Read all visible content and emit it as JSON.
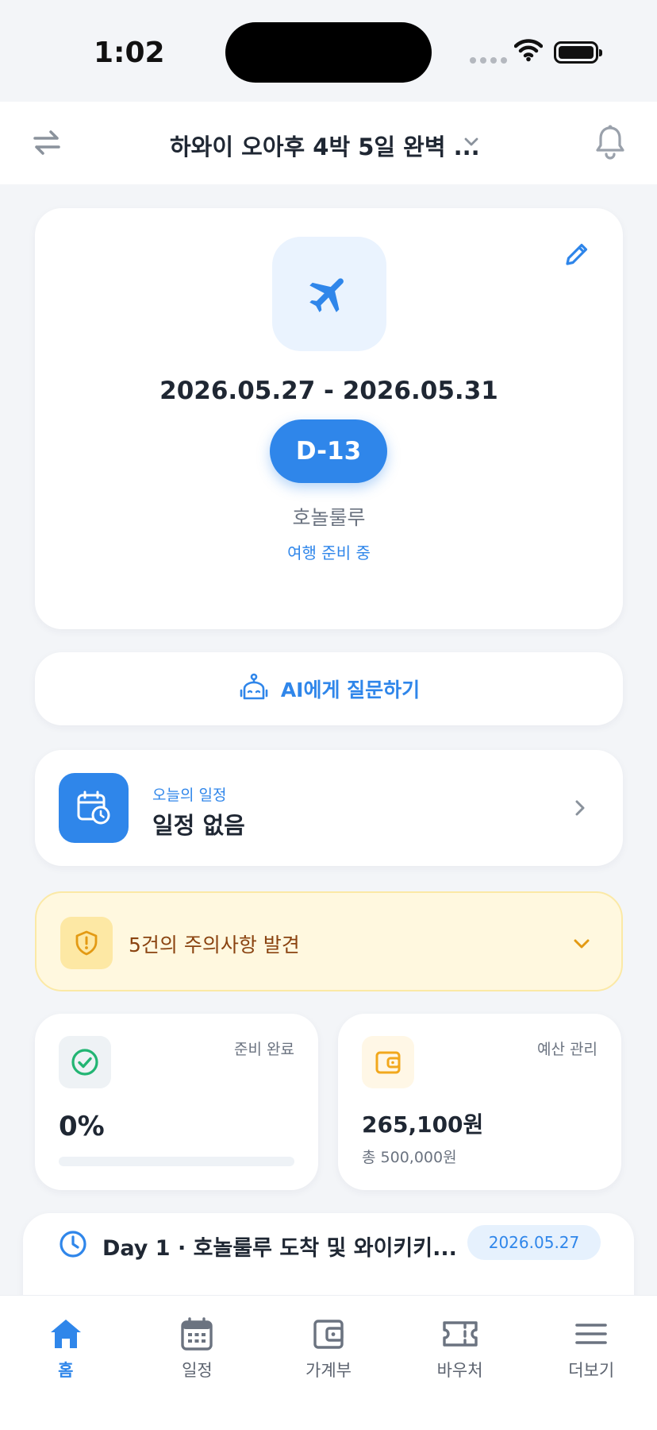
{
  "status_bar": {
    "time": "1:02"
  },
  "header": {
    "title": "하와이 오아후 4박 5일 완벽 ..."
  },
  "trip": {
    "date_range": "2026.05.27 - 2026.05.31",
    "dday": "D-13",
    "city": "호놀룰루",
    "status": "여행 준비 중"
  },
  "ai": {
    "label": "AI에게 질문하기"
  },
  "today": {
    "label": "오늘의 일정",
    "value": "일정 없음"
  },
  "warnings": {
    "label": "5건의 주의사항 발견"
  },
  "prep": {
    "label": "준비 완료",
    "value": "0%",
    "progress": 0
  },
  "budget": {
    "label": "예산 관리",
    "spent": "265,100원",
    "total": "총 500,000원"
  },
  "day": {
    "title": "Day 1 · 호놀룰루 도착 및 와이키키...",
    "date": "2026.05.27"
  },
  "tabs": [
    {
      "label": "홈",
      "icon": "home-icon"
    },
    {
      "label": "일정",
      "icon": "calendar-icon"
    },
    {
      "label": "가계부",
      "icon": "wallet-icon"
    },
    {
      "label": "바우처",
      "icon": "ticket-icon"
    },
    {
      "label": "더보기",
      "icon": "menu-icon"
    }
  ],
  "colors": {
    "accent": "#2f86ea",
    "warning_bg": "#fff8df",
    "warning_text": "#8a4310",
    "success": "#22b573",
    "budget": "#f2a81d"
  }
}
